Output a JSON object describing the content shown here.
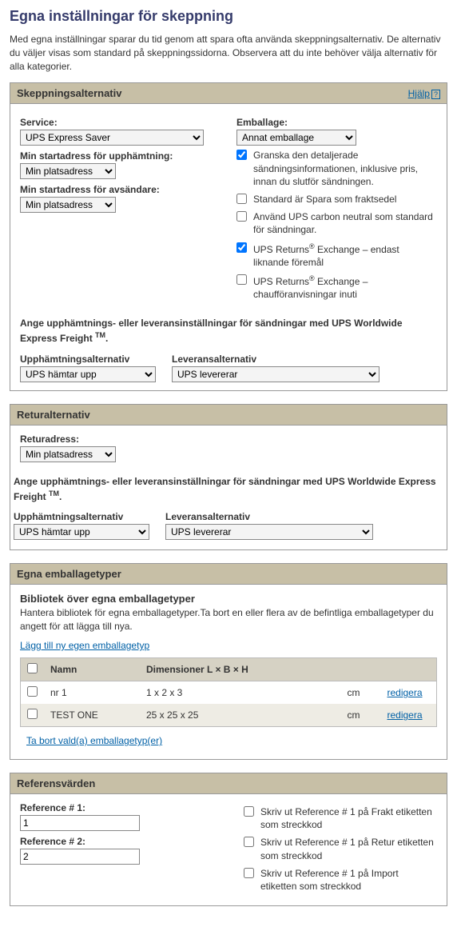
{
  "page": {
    "title": "Egna inställningar för skeppning",
    "intro": "Med egna inställningar sparar du tid genom att spara ofta använda skeppningsalternativ. De alternativ du väljer visas som standard på skeppningssidorna. Observera att du inte behöver välja alternativ för alla kategorier."
  },
  "shipping": {
    "header": "Skeppningsalternativ",
    "help": "Hjälp",
    "service_label": "Service:",
    "service_value": "UPS Express Saver",
    "pickup_addr_label": "Min startadress för upphämtning:",
    "pickup_addr_value": "Min platsadress",
    "sender_addr_label": "Min startadress för avsändare:",
    "sender_addr_value": "Min platsadress",
    "packaging_label": "Emballage:",
    "packaging_value": "Annat emballage",
    "checks": [
      {
        "checked": true,
        "label": "Granska den detaljerade sändningsinformationen, inklusive pris, innan du slutför sändningen."
      },
      {
        "checked": false,
        "label": "Standard är Spara som fraktsedel"
      },
      {
        "checked": false,
        "label": "Använd UPS carbon neutral som standard för sändningar."
      },
      {
        "checked": true,
        "label_html": "UPS Returns<sup>®</sup> Exchange – endast liknande föremål"
      },
      {
        "checked": false,
        "label_html": "UPS Returns<sup>®</sup> Exchange – chaufföranvisningar inuti"
      }
    ],
    "freight_note_pre": "Ange upphämtnings- eller leveransinställningar för sändningar med UPS Worldwide Express Freight",
    "freight_note_tm": "TM",
    "pickup_opt_label": "Upphämtningsalternativ",
    "pickup_opt_value": "UPS hämtar upp",
    "delivery_opt_label": "Leveransalternativ",
    "delivery_opt_value": "UPS levererar"
  },
  "returns": {
    "header": "Returalternativ",
    "return_addr_label": "Returadress:",
    "return_addr_value": "Min platsadress",
    "freight_note_pre": "Ange upphämtnings- eller leveransinställningar för sändningar med UPS Worldwide Express Freight",
    "freight_note_tm": "TM",
    "pickup_opt_label": "Upphämtningsalternativ",
    "pickup_opt_value": "UPS hämtar upp",
    "delivery_opt_label": "Leveransalternativ",
    "delivery_opt_value": "UPS levererar"
  },
  "packages": {
    "header": "Egna emballagetyper",
    "subhead": "Bibliotek över egna emballagetyper",
    "subtext": "Hantera bibliotek för egna emballagetyper.Ta bort en eller flera av de befintliga emballagetyper du angett för att lägga till nya.",
    "add_link": "Lägg till ny egen emballagetyp",
    "cols": {
      "name": "Namn",
      "dims": "Dimensioner L × B × H"
    },
    "rows": [
      {
        "name": "nr 1",
        "dims": "1 x 2 x 3",
        "unit": "cm",
        "action": "redigera"
      },
      {
        "name": "TEST ONE",
        "dims": "25 x 25 x 25",
        "unit": "cm",
        "action": "redigera"
      }
    ],
    "remove_link": "Ta bort vald(a) emballagetyp(er)"
  },
  "refs": {
    "header": "Referensvärden",
    "ref1_label": "Reference # 1:",
    "ref1_value": "1",
    "ref2_label": "Reference # 2:",
    "ref2_value": "2",
    "checks": [
      {
        "checked": false,
        "label": "Skriv ut Reference # 1 på Frakt etiketten som streckkod"
      },
      {
        "checked": false,
        "label": "Skriv ut Reference # 1 på Retur etiketten som streckkod"
      },
      {
        "checked": false,
        "label": "Skriv ut Reference # 1 på Import etiketten som streckkod"
      }
    ]
  }
}
